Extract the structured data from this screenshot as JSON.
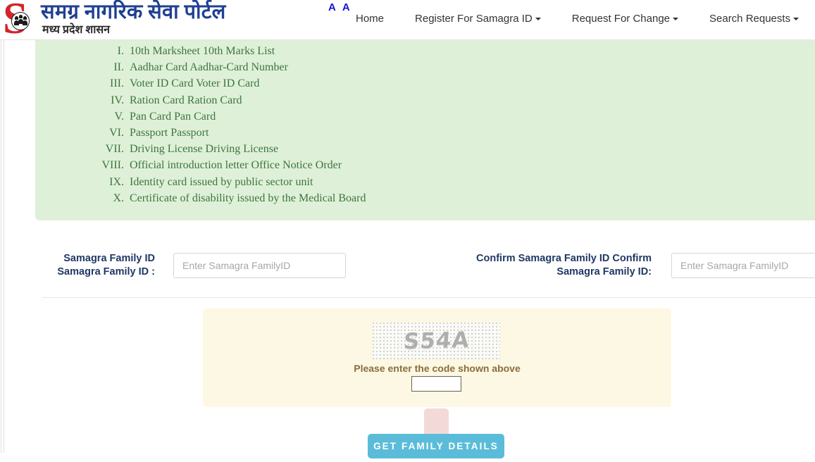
{
  "header": {
    "logo": {
      "letter": "S",
      "icon_name": "family-group-icon"
    },
    "brand_title": "समग्र नागरिक सेवा पोर्टल",
    "brand_subtitle": "मध्य प्रदेश शासन",
    "font_size_control": "A A",
    "nav": [
      {
        "label": "Home",
        "has_caret": false
      },
      {
        "label": "Register For Samagra ID",
        "has_caret": true
      },
      {
        "label": "Request For Change",
        "has_caret": true
      },
      {
        "label": "Search Requests",
        "has_caret": true
      }
    ]
  },
  "notice": {
    "background_color": "#dff0d8",
    "text_color": "#3c763d",
    "documents": [
      "10th Marksheet 10th Marks List",
      "Aadhar Card Aadhar-Card Number",
      "Voter ID Card Voter ID Card",
      "Ration Card Ration Card",
      "Pan Card Pan Card",
      "Passport Passport",
      "Driving License Driving License",
      "Official introduction letter Office Notice Order",
      "Identity card issued by public sector unit",
      "Certificate of disability issued by the Medical Board"
    ]
  },
  "form": {
    "family_id": {
      "label": "Samagra Family ID Samagra Family ID :",
      "placeholder": "Enter Samagra FamilyID",
      "value": ""
    },
    "confirm_family_id": {
      "label": "Confirm Samagra Family ID Confirm Samagra Family ID:",
      "placeholder": "Enter Samagra FamilyID",
      "value": ""
    }
  },
  "captcha": {
    "code": "S54A",
    "hint": "Please enter the code shown above",
    "input_value": "",
    "panel_color": "#fcf8e3",
    "hint_color": "#8a6d3b"
  },
  "submit": {
    "label": "Get Family Details",
    "color": "#5bbcd9",
    "tab_color": "#f4d9d9"
  }
}
